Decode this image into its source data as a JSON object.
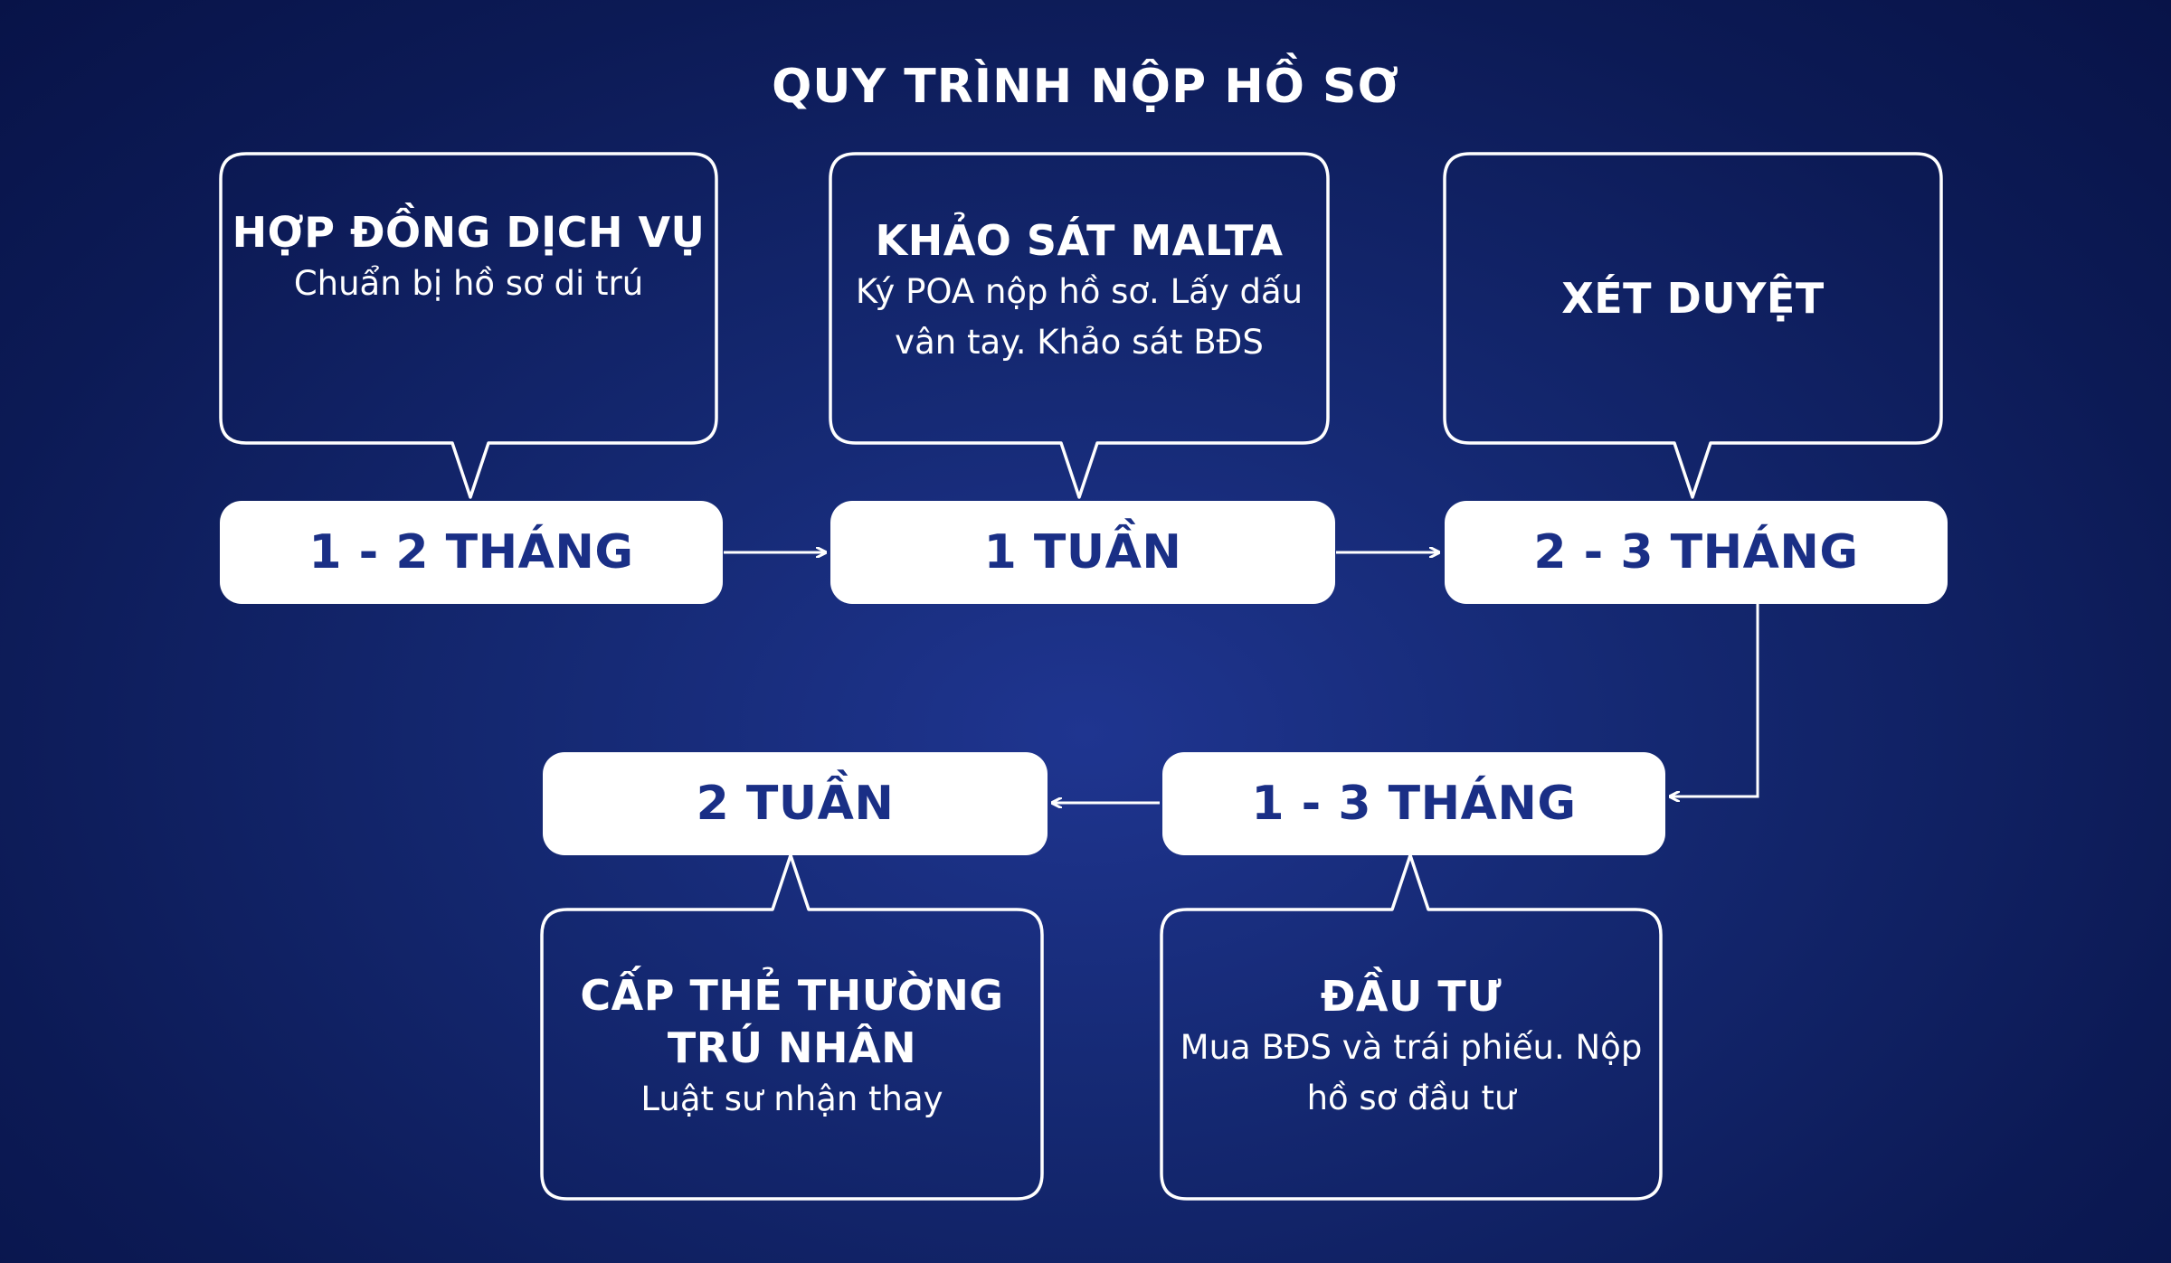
{
  "title": "QUY TRÌNH NỘP HỒ SƠ",
  "steps": [
    {
      "duration": "1 - 2 THÁNG",
      "title": "HỢP ĐỒNG DỊCH VỤ",
      "description": "Chuẩn bị hồ sơ di trú"
    },
    {
      "duration": "1 TUẦN",
      "title": "KHẢO SÁT MALTA",
      "description_lines": [
        "Ký POA nộp hồ sơ. Lấy dấu",
        "vân tay. Khảo sát BĐS"
      ]
    },
    {
      "duration": "2 - 3 THÁNG",
      "title": "XÉT DUYỆT"
    },
    {
      "duration": "1 - 3 THÁNG",
      "title": "ĐẦU TƯ",
      "description_lines": [
        "Mua BĐS và trái phiếu. Nộp",
        "hồ sơ đầu tư"
      ]
    },
    {
      "duration": "2 TUẦN",
      "title_lines": [
        "CẤP THẺ THƯỜNG",
        "TRÚ NHÂN"
      ],
      "description": "Luật sư nhận thay"
    }
  ],
  "colors": {
    "background": "#0c1a55",
    "pill": "#ffffff",
    "pill_text": "#1a2f86",
    "stroke": "#ffffff"
  }
}
